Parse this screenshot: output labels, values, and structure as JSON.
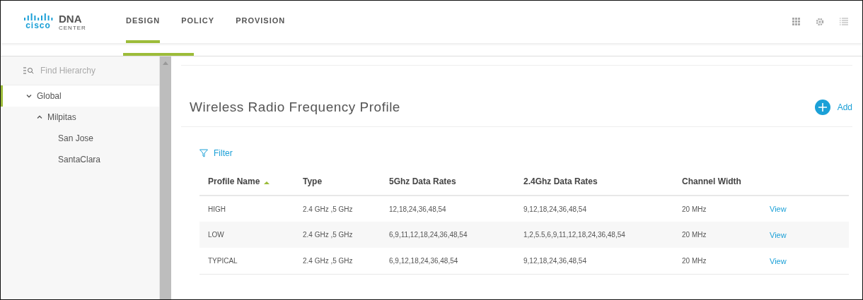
{
  "logo": {
    "brand": "cisco",
    "product": "DNA",
    "sub": "CENTER"
  },
  "nav": [
    {
      "label": "DESIGN",
      "selected": true
    },
    {
      "label": "POLICY",
      "selected": false
    },
    {
      "label": "PROVISION",
      "selected": false
    }
  ],
  "sidebar": {
    "search": {
      "placeholder": "Find Hierarchy"
    },
    "tree": [
      {
        "label": "Global",
        "expanded": true,
        "selected": true,
        "children": [
          {
            "label": "Milpitas",
            "expanded": true,
            "selected": false,
            "children": [
              {
                "label": "San Jose",
                "selected": false
              },
              {
                "label": "SantaClara",
                "selected": false
              }
            ]
          }
        ]
      }
    ]
  },
  "page": {
    "title": "Wireless Radio Frequency Profile",
    "add_label": "Add",
    "filter_label": "Filter"
  },
  "table": {
    "columns": [
      {
        "label": "Profile Name",
        "sorted": true
      },
      {
        "label": "Type",
        "sorted": false
      },
      {
        "label": "5Ghz Data Rates",
        "sorted": false
      },
      {
        "label": "2.4Ghz Data Rates",
        "sorted": false
      },
      {
        "label": "Channel Width",
        "sorted": false
      }
    ],
    "rows": [
      {
        "cells": [
          "HIGH",
          "2.4 GHz ,5 GHz",
          "12,18,24,36,48,54",
          "9,12,18,24,36,48,54",
          "20 MHz"
        ],
        "action": "View"
      },
      {
        "cells": [
          "LOW",
          "2.4 GHz ,5 GHz",
          "6,9,11,12,18,24,36,48,54",
          "1,2,5.5,6,9,11,12,18,24,36,48,54",
          "20 MHz"
        ],
        "action": "View"
      },
      {
        "cells": [
          "TYPICAL",
          "2.4 GHz ,5 GHz",
          "6,9,12,18,24,36,48,54",
          "9,12,18,24,36,48,54",
          "20 MHz"
        ],
        "action": "View"
      }
    ]
  }
}
